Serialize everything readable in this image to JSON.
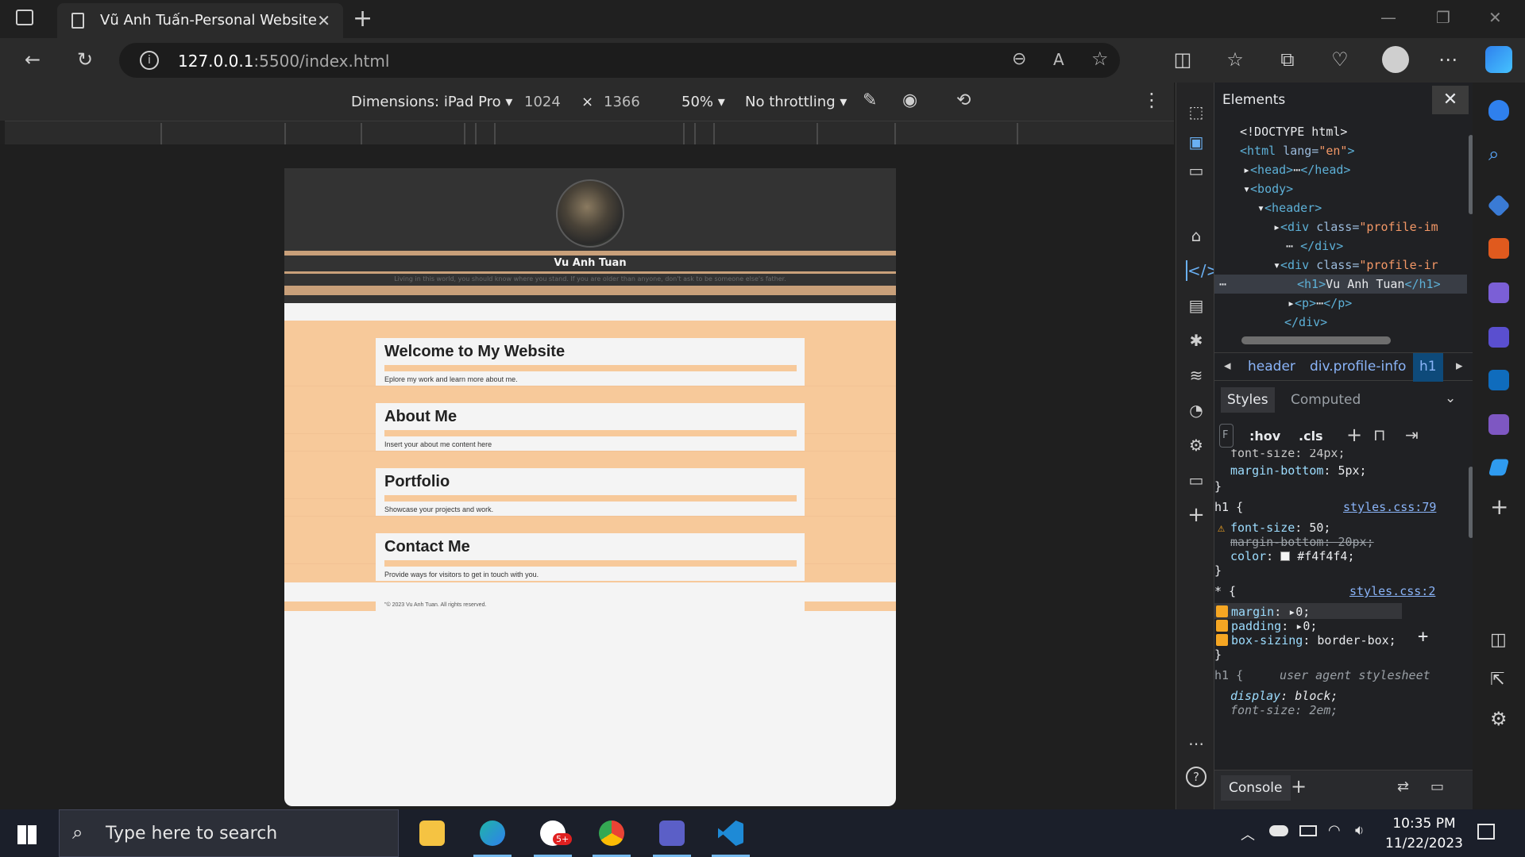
{
  "browser": {
    "tab_title": "Vũ Anh Tuấn-Personal Website",
    "url_host": "127.0.0.1",
    "url_rest": ":5500/index.html"
  },
  "device_toolbar": {
    "dimensions_label": "Dimensions: iPad Pro",
    "width": "1024",
    "times": "×",
    "height": "1366",
    "zoom": "50%",
    "throttling": "No throttling"
  },
  "website": {
    "name": "Vu Anh Tuan",
    "tagline": "Living in this world, you should know where you stand. If you are older than anyone, don't ask to be someone else's father.",
    "sections": [
      {
        "title": "Welcome to My Website",
        "text": "Eplore my work and learn more about me."
      },
      {
        "title": "About Me",
        "text": "Insert your about me content here"
      },
      {
        "title": "Portfolio",
        "text": "Showcase your projects and work."
      },
      {
        "title": "Contact Me",
        "text": "Provide ways for visitors to get in touch with you."
      }
    ],
    "footer": "\"© 2023 Vu Anh Tuan. All rights reserved."
  },
  "devtools": {
    "panel_title": "Elements",
    "dom": {
      "doctype": "<!DOCTYPE html>",
      "html_open": "<html",
      "lang_attr": "lang=",
      "lang_val": "\"en\"",
      "head": "<head>",
      "head_close": "</head>",
      "body": "<body>",
      "header": "<header>",
      "div1": "<div",
      "class_attr": "class=",
      "class_val_1": "\"profile-im",
      "div_close": "</div>",
      "div2": "<div",
      "class_val_2": "\"profile-ir",
      "h1_open": "<h1>",
      "h1_text": "Vu Anh Tuan",
      "h1_close": "</h1>",
      "p_open": "<p>",
      "p_close": "</p>",
      "div_close_2": "</div>"
    },
    "breadcrumbs": [
      "header",
      "div.profile-info",
      "h1"
    ],
    "tabs": {
      "styles": "Styles",
      "computed": "Computed"
    },
    "toolbar": {
      "filter": "F",
      "hov": ":hov",
      "cls": ".cls"
    },
    "rules": {
      "partial_1": "font-size: 24px;",
      "partial_2_prop": "margin-bottom",
      "partial_2_val": "5px;",
      "h1_selector": "h1 {",
      "h1_source": "styles.css:79",
      "h1_font_prop": "font-size",
      "h1_font_val": "50;",
      "h1_margin": "margin-bottom: 20px;",
      "h1_color_prop": "color",
      "h1_color_val": "#f4f4f4;",
      "star_selector": "* {",
      "star_source": "styles.css:2",
      "margin_prop": "margin",
      "margin_val": "0;",
      "padding_prop": "padding",
      "padding_val": "0;",
      "boxsizing_prop": "box-sizing",
      "boxsizing_val": "border-box;",
      "ua_selector": "h1 {",
      "ua_source": "user agent stylesheet",
      "display_prop": "display",
      "display_val": "block;",
      "cut_line": "font-size: 2em;",
      "close_brace": "}"
    },
    "console_tab": "Console"
  },
  "taskbar": {
    "search_placeholder": "Type here to search",
    "time": "10:35 PM",
    "date": "11/22/2023",
    "zalo_badge": "5+"
  },
  "colors": {
    "accent_tan": "#c9a07a",
    "peach": "#f7c99a",
    "header_bg": "#333333",
    "page_bg": "#f4f4f4"
  }
}
